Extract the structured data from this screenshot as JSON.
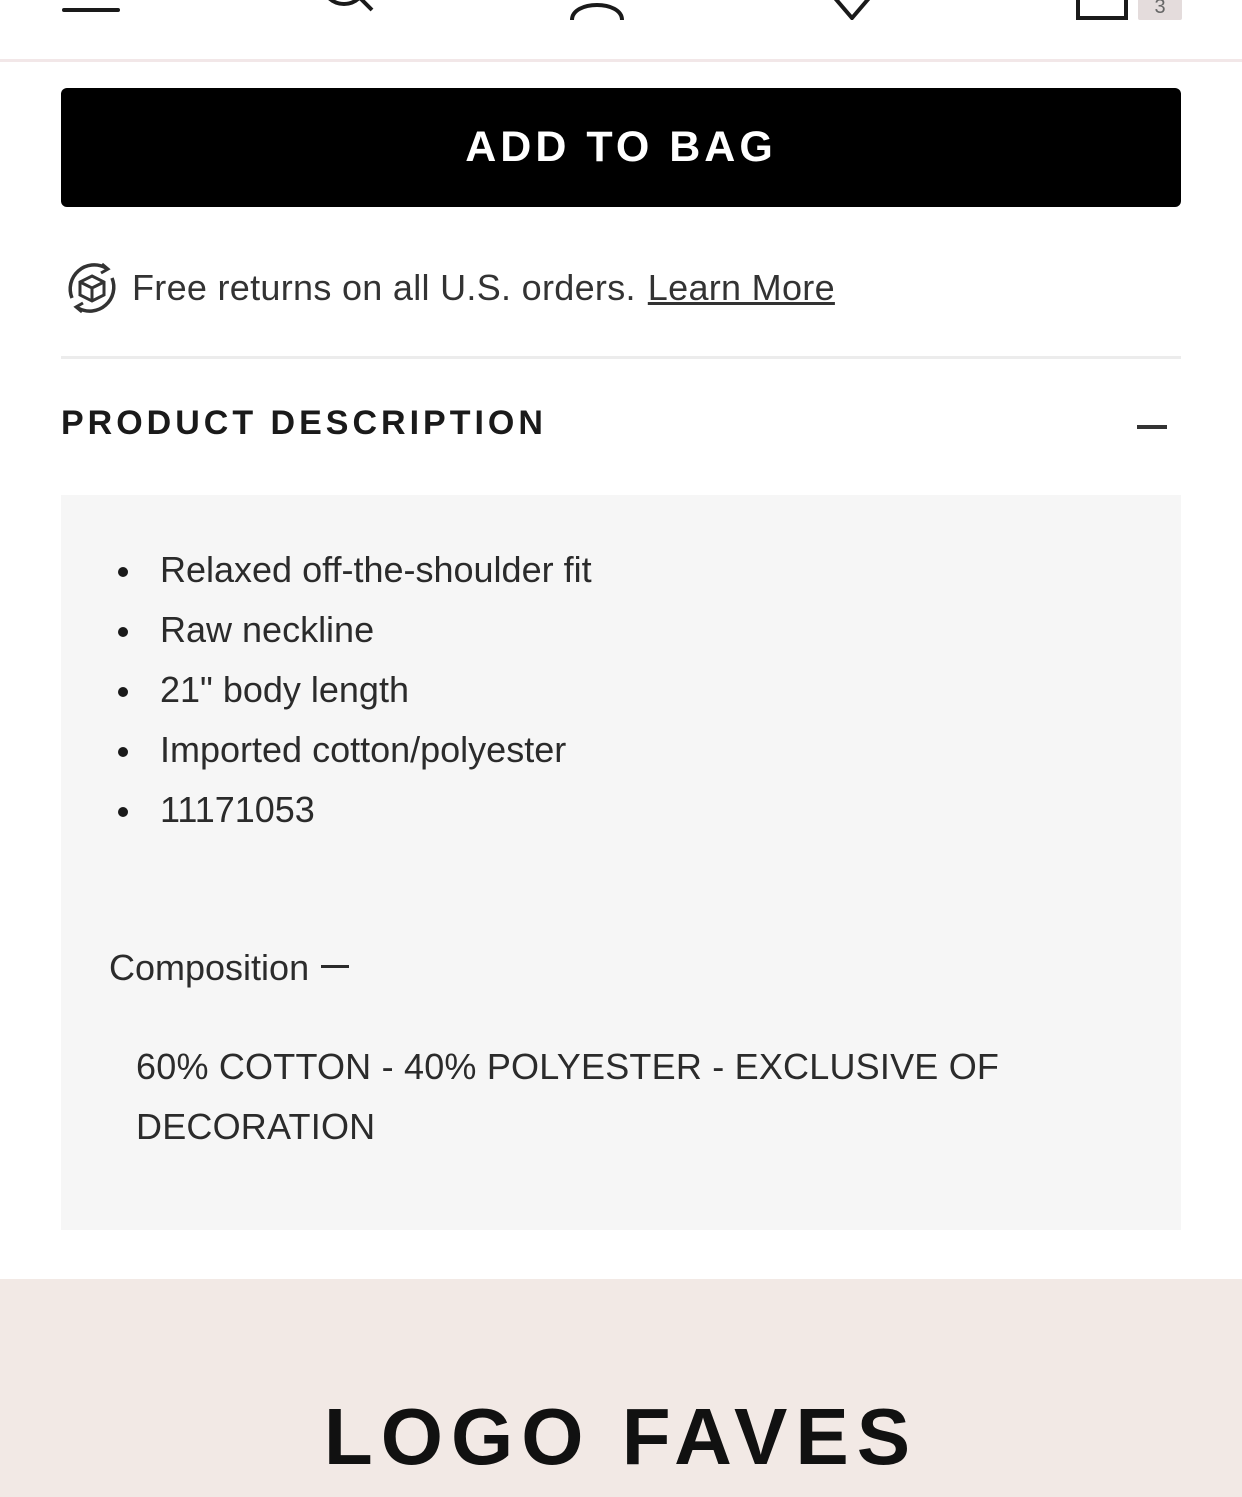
{
  "nav": {
    "icons": [
      "menu-icon",
      "search-icon",
      "account-icon",
      "wishlist-icon",
      "bag-icon"
    ],
    "bag_count": "3"
  },
  "product": {
    "add_to_bag_label": "ADD TO BAG",
    "returns_text": "Free returns on all U.S. orders.",
    "learn_more_label": "Learn More"
  },
  "description": {
    "title": "PRODUCT DESCRIPTION",
    "items": [
      "Relaxed off-the-shoulder fit",
      "Raw neckline",
      "21\" body length",
      "Imported cotton/polyester",
      "11171053"
    ],
    "composition_label": "Composition",
    "composition_text": "60% COTTON - 40% POLYESTER - EXCLUSIVE OF DECORATION"
  },
  "faves": {
    "title": "LOGO FAVES"
  },
  "colors": {
    "button_bg": "#000000",
    "panel_bg": "#f6f6f6",
    "faves_bg": "#f2e9e5"
  }
}
